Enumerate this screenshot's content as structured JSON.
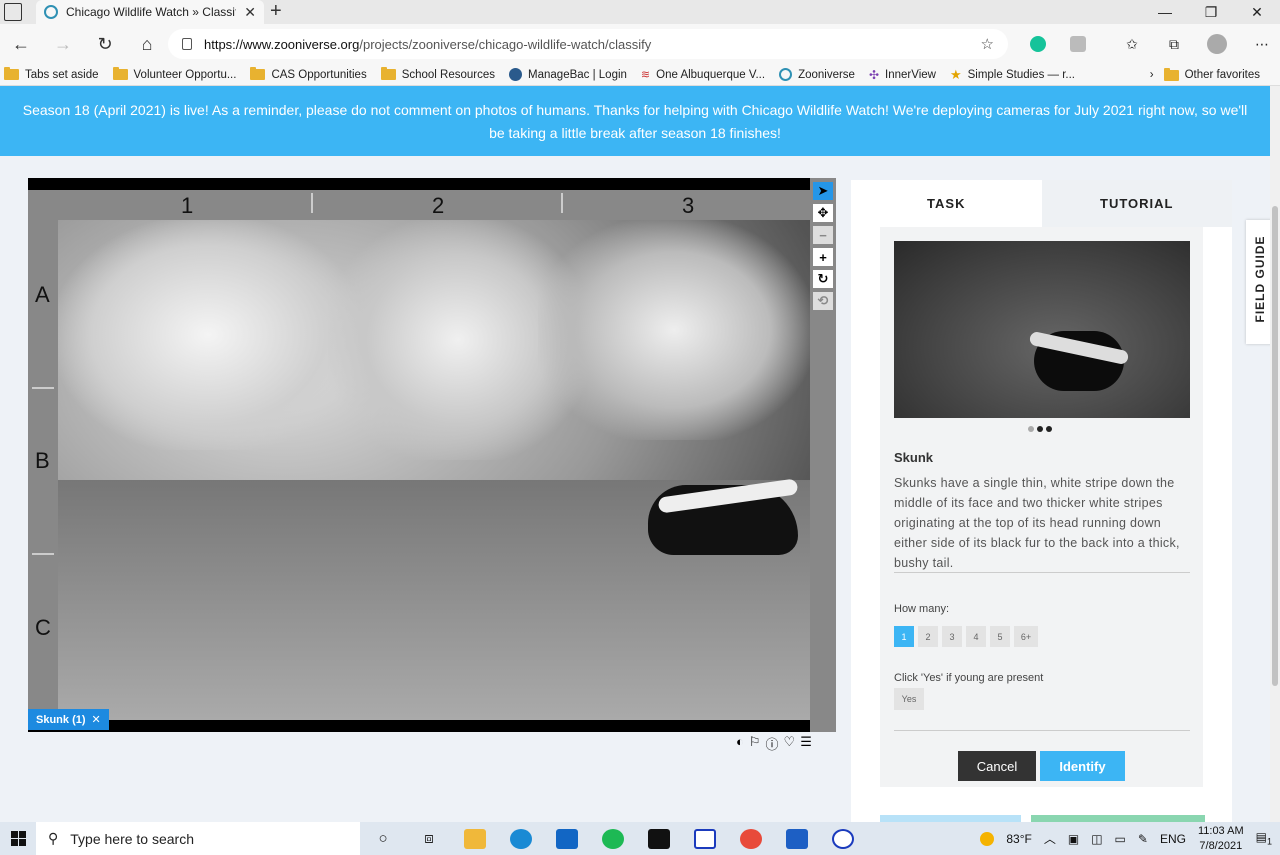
{
  "browser": {
    "tab_title": "Chicago Wildlife Watch » Classify",
    "url_host": "https://www.zooniverse.org",
    "url_path": "/projects/zooniverse/chicago-wildlife-watch/classify"
  },
  "favorites": [
    {
      "label": "Tabs set aside",
      "icon": "folder-icon"
    },
    {
      "label": "Volunteer Opportu...",
      "icon": "folder-icon"
    },
    {
      "label": "CAS Opportunities",
      "icon": "folder-icon"
    },
    {
      "label": "School Resources",
      "icon": "folder-icon"
    },
    {
      "label": "ManageBac | Login",
      "icon": "managebac-icon"
    },
    {
      "label": "One Albuquerque V...",
      "icon": "flag-icon"
    },
    {
      "label": "Zooniverse",
      "icon": "zooniverse-icon"
    },
    {
      "label": "InnerView",
      "icon": "innerview-icon"
    },
    {
      "label": "Simple Studies — r...",
      "icon": "star-icon"
    }
  ],
  "favorites_other": "Other favorites",
  "banner": {
    "text": "Season 18 (April 2021) is live! As a reminder, please do not comment on photos of humans. Thanks for helping with Chicago Wildlife Watch! We're deploying cameras for July 2021 right now, so we'll be taking a little break after season 18 finishes!"
  },
  "grid": {
    "columns": [
      "1",
      "2",
      "3"
    ],
    "rows": [
      "A",
      "B",
      "C"
    ]
  },
  "selection_tag": "Skunk (1)",
  "panel": {
    "tab_task": "TASK",
    "tab_tutorial": "TUTORIAL",
    "species_name": "Skunk",
    "species_description": "Skunks have a single thin, white stripe down the middle of its face and two thicker white stripes originating at the top of its head running down either side of its black fur to the back into a thick, bushy tail.",
    "question_how_many": "How many:",
    "count_options": [
      "1",
      "2",
      "3",
      "4",
      "5",
      "6+"
    ],
    "selected_count": "1",
    "question_young": "Click 'Yes' if young are present",
    "yes_label": "Yes",
    "cancel_label": "Cancel",
    "identify_label": "Identify",
    "field_guide": "FIELD GUIDE"
  },
  "taskbar": {
    "search_placeholder": "Type here to search",
    "weather": "83°F",
    "language": "ENG",
    "time": "11:03 AM",
    "date": "7/8/2021",
    "notifications": "1"
  },
  "colors": {
    "accent": "#3cb5f4",
    "tag": "#1d8ae0",
    "cancel": "#333333"
  }
}
